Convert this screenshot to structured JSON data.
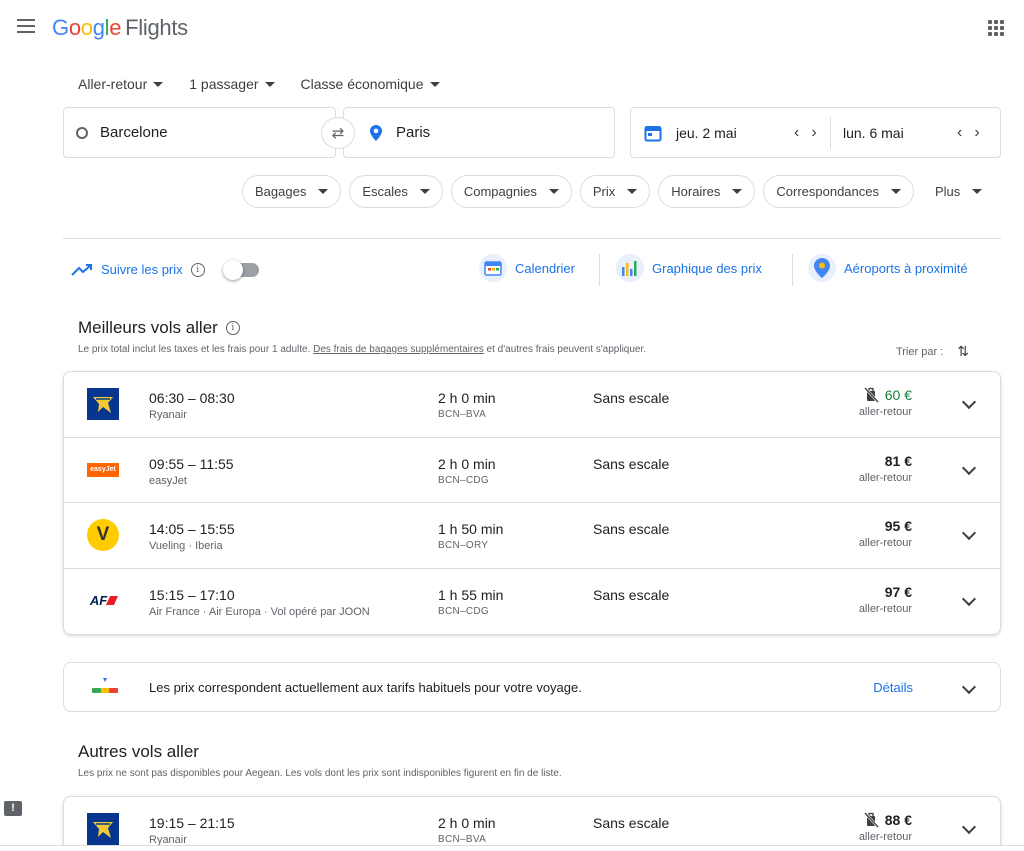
{
  "header": {
    "logo": {
      "g1": "G",
      "o1": "o",
      "o2": "o",
      "g2": "g",
      "l": "l",
      "e": "e",
      "product": "Flights"
    }
  },
  "search": {
    "trip_type": "Aller-retour",
    "passengers": "1 passager",
    "cabin": "Classe économique",
    "from": "Barcelone",
    "to": "Paris",
    "depart_date": "jeu. 2 mai",
    "return_date": "lun. 6 mai"
  },
  "filters": [
    "Bagages",
    "Escales",
    "Compagnies",
    "Prix",
    "Horaires",
    "Correspondances",
    "Plus"
  ],
  "tools": {
    "track_prices": "Suivre les prix",
    "calendar": "Calendrier",
    "price_graph": "Graphique des prix",
    "nearby_airports": "Aéroports à proximité"
  },
  "best": {
    "title": "Meilleurs vols aller",
    "subtitle_start": "Le prix total inclut les taxes et les frais pour 1 adulte. ",
    "subtitle_link": "Des frais de bagages supplémentaires",
    "subtitle_end": " et d'autres frais peuvent s'appliquer.",
    "sort_label": "Trier par :",
    "flights": [
      {
        "times": "06:30 – 08:30",
        "airline": "Ryanair",
        "duration": "2 h 0 min",
        "route": "BCN–BVA",
        "stops": "Sans escale",
        "price": "60 €",
        "price_note": "aller-retour"
      },
      {
        "times": "09:55 – 11:55",
        "airline": "easyJet",
        "duration": "2 h 0 min",
        "route": "BCN–CDG",
        "stops": "Sans escale",
        "price": "81 €",
        "price_note": "aller-retour",
        "logo_text": "easyJet"
      },
      {
        "times": "14:05 – 15:55",
        "airline": "Vueling · Iberia",
        "duration": "1 h 50 min",
        "route": "BCN–ORY",
        "stops": "Sans escale",
        "price": "95 €",
        "price_note": "aller-retour",
        "logo_text": "V"
      },
      {
        "times": "15:15 – 17:10",
        "airline": "Air France · Air Europa · Vol opéré par JOON",
        "duration": "1 h 55 min",
        "route": "BCN–CDG",
        "stops": "Sans escale",
        "price": "97 €",
        "price_note": "aller-retour",
        "logo_text": "AF"
      }
    ]
  },
  "insight": {
    "text": "Les prix correspondent actuellement aux tarifs habituels pour votre voyage.",
    "details": "Détails"
  },
  "other": {
    "title": "Autres vols aller",
    "subtitle": "Les prix ne sont pas disponibles pour Aegean. Les vols dont les prix sont indisponibles figurent en fin de liste.",
    "flights": [
      {
        "times": "19:15 – 21:15",
        "airline": "Ryanair",
        "duration": "2 h 0 min",
        "route": "BCN–BVA",
        "stops": "Sans escale",
        "price": "88 €",
        "price_note": "aller-retour"
      }
    ]
  },
  "feedback": "!",
  "colors": {
    "accent": "#1a73e8",
    "price_low": "#188038",
    "ryanair": "#073590",
    "easyjet": "#ff6600",
    "vueling": "#ffcc00",
    "airfrance": "#002157"
  }
}
